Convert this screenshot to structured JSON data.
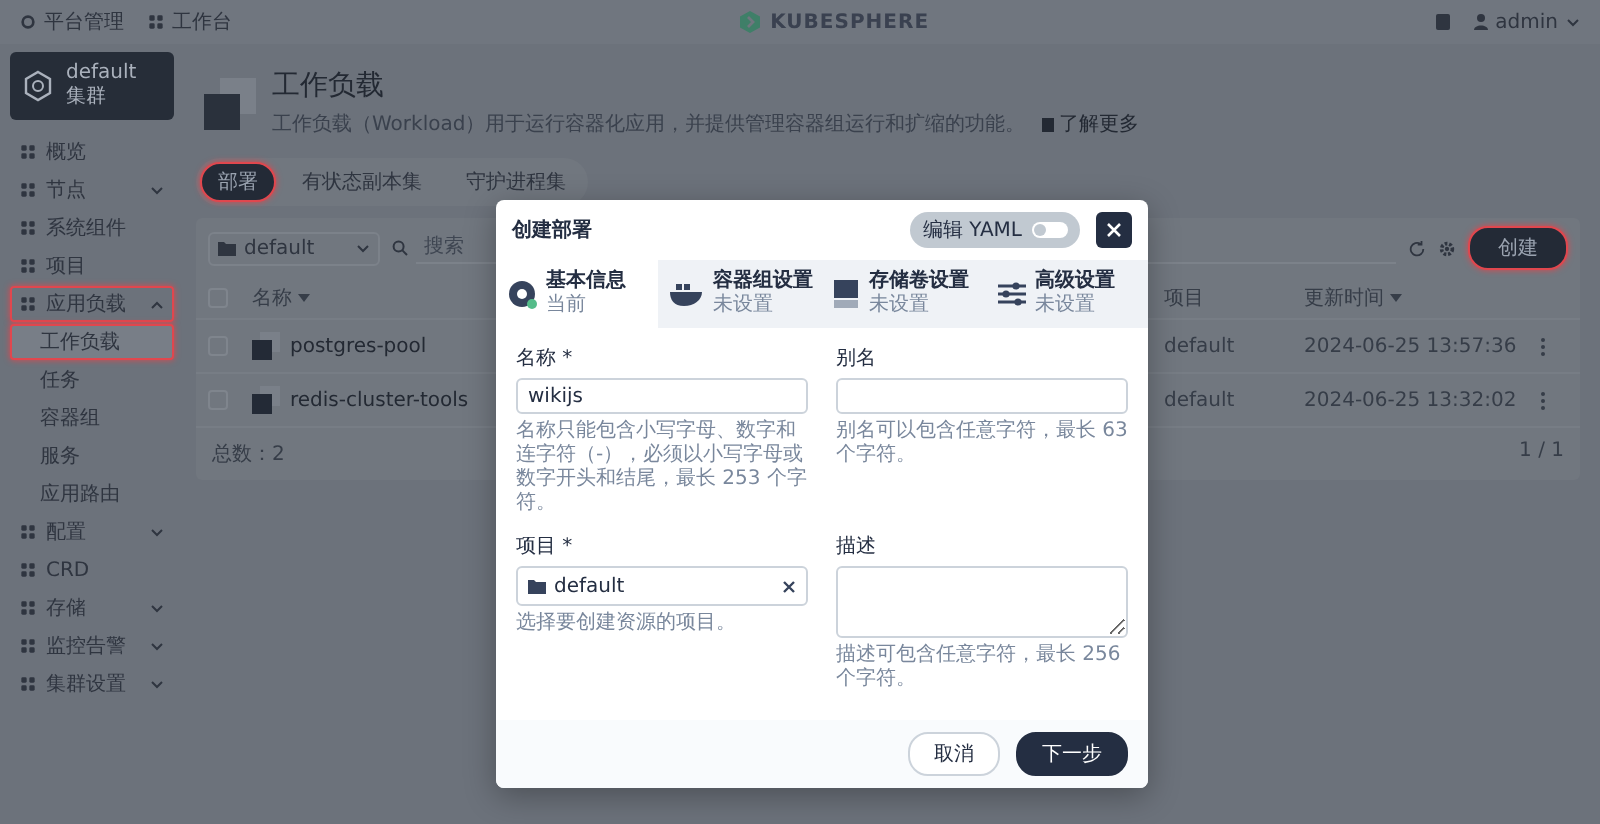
{
  "top_bar": {
    "nav": [
      {
        "label": "平台管理"
      },
      {
        "label": "工作台"
      }
    ],
    "logo": "KUBESPHERE",
    "user": "admin"
  },
  "sidebar": {
    "cluster": {
      "name": "default",
      "label": "集群"
    },
    "items": [
      {
        "label": "概览",
        "kind": "link",
        "highlighted": false
      },
      {
        "label": "节点",
        "kind": "group",
        "expanded": false,
        "highlighted": false
      },
      {
        "label": "系统组件",
        "kind": "link",
        "highlighted": false
      },
      {
        "label": "项目",
        "kind": "link",
        "highlighted": false
      },
      {
        "label": "应用负载",
        "kind": "group",
        "expanded": true,
        "highlighted": true,
        "children": [
          {
            "label": "工作负载",
            "selected": true,
            "highlighted": true
          },
          {
            "label": "任务",
            "selected": false,
            "highlighted": false
          },
          {
            "label": "容器组",
            "selected": false,
            "highlighted": false
          },
          {
            "label": "服务",
            "selected": false,
            "highlighted": false
          },
          {
            "label": "应用路由",
            "selected": false,
            "highlighted": false
          }
        ]
      },
      {
        "label": "配置",
        "kind": "group",
        "expanded": false,
        "highlighted": false
      },
      {
        "label": "CRD",
        "kind": "link",
        "highlighted": false
      },
      {
        "label": "存储",
        "kind": "group",
        "expanded": false,
        "highlighted": false
      },
      {
        "label": "监控告警",
        "kind": "group",
        "expanded": false,
        "highlighted": false
      },
      {
        "label": "集群设置",
        "kind": "group",
        "expanded": false,
        "highlighted": false
      }
    ]
  },
  "page": {
    "title": "工作负载",
    "description": "工作负载（Workload）用于运行容器化应用，并提供管理容器组运行和扩缩的功能。",
    "learn_more": "了解更多"
  },
  "tabs": [
    {
      "label": "部署",
      "selected": true,
      "highlighted": true
    },
    {
      "label": "有状态副本集",
      "selected": false,
      "highlighted": false
    },
    {
      "label": "守护进程集",
      "selected": false,
      "highlighted": false
    }
  ],
  "toolbar": {
    "project": "default",
    "search": {
      "placeholder": "搜索"
    },
    "create": {
      "label": "创建",
      "highlighted": true
    }
  },
  "table": {
    "all_selected": false,
    "columns": [
      "名称",
      "项目",
      "更新时间"
    ],
    "rows": [
      {
        "name": "postgres-pool",
        "project": "default",
        "updated": "2024-06-25 13:57:36",
        "selected": false
      },
      {
        "name": "redis-cluster-tools",
        "project": "default",
        "updated": "2024-06-25 13:32:02",
        "selected": false
      }
    ],
    "total": "总数：2",
    "pagination": "1 / 1"
  },
  "modal": {
    "title": "创建部署",
    "yaml": {
      "label": "编辑 YAML",
      "on": false
    },
    "steps": [
      {
        "title": "基本信息",
        "status": "当前",
        "selected": true
      },
      {
        "title": "容器组设置",
        "status": "未设置",
        "selected": false
      },
      {
        "title": "存储卷设置",
        "status": "未设置",
        "selected": false
      },
      {
        "title": "高级设置",
        "status": "未设置",
        "selected": false
      }
    ],
    "fields": [
      {
        "kind": "input",
        "label": "名称 *",
        "value": "wikijs",
        "hint": "名称只能包含小写字母、数字和连字符（-），必须以小写字母或数字开头和结尾，最长 253 个字符。"
      },
      {
        "kind": "input",
        "label": "别名",
        "hint": "别名可以包含任意字符，最长 63 个字符。"
      },
      {
        "kind": "select",
        "label": "项目 *",
        "value": "default",
        "hint": "选择要创建资源的项目。"
      },
      {
        "kind": "textarea",
        "label": "描述",
        "hint": "描述可包含任意字符，最长 256 个字符。"
      }
    ],
    "buttons": [
      {
        "label": "取消",
        "kind": "secondary"
      },
      {
        "label": "下一步",
        "kind": "primary"
      }
    ]
  }
}
